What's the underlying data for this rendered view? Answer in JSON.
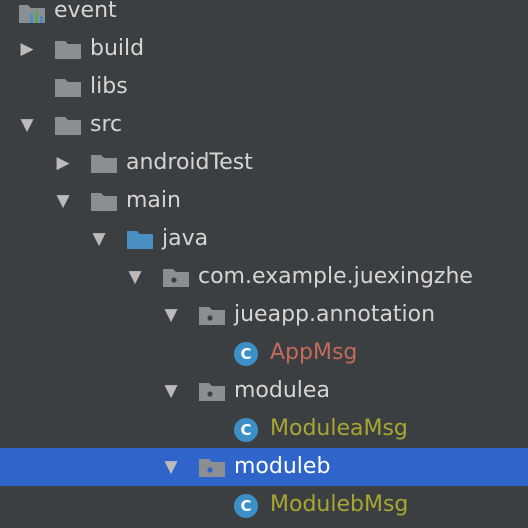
{
  "project_tree": {
    "items": [
      {
        "label": "event",
        "icon": "module-folder-icon",
        "state": "none"
      },
      {
        "label": "build",
        "icon": "folder-icon",
        "state": "collapsed"
      },
      {
        "label": "libs",
        "icon": "folder-icon",
        "state": "none"
      },
      {
        "label": "src",
        "icon": "folder-icon",
        "state": "expanded"
      },
      {
        "label": "androidTest",
        "icon": "folder-icon",
        "state": "collapsed"
      },
      {
        "label": "main",
        "icon": "folder-icon",
        "state": "expanded"
      },
      {
        "label": "java",
        "icon": "source-folder-icon",
        "state": "expanded"
      },
      {
        "label": "com.example.juexingzhe",
        "icon": "package-icon",
        "state": "expanded"
      },
      {
        "label": "jueapp.annotation",
        "icon": "package-icon",
        "state": "expanded"
      },
      {
        "label": "AppMsg",
        "icon": "class-icon",
        "state": "none"
      },
      {
        "label": "modulea",
        "icon": "package-icon",
        "state": "expanded"
      },
      {
        "label": "ModuleaMsg",
        "icon": "class-icon",
        "state": "none"
      },
      {
        "label": "moduleb",
        "icon": "package-icon",
        "state": "expanded",
        "selected": true
      },
      {
        "label": "ModulebMsg",
        "icon": "class-icon",
        "state": "none"
      }
    ],
    "class_icon_letter": "C",
    "colors": {
      "background": "#3c3f41",
      "selection": "#2f65ca",
      "folder": "#8b8f92",
      "source_folder": "#4a8fc4",
      "modified_file": "#c46a5a",
      "added_file": "#a8a632",
      "class_icon": "#3c90c8"
    }
  }
}
